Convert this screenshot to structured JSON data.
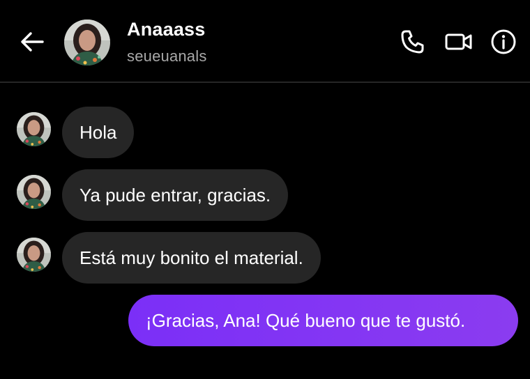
{
  "header": {
    "name": "Anaaass",
    "username": "seueuanals"
  },
  "icons": {
    "back": "arrow-left-icon",
    "call": "phone-icon",
    "video": "video-camera-icon",
    "info": "info-icon"
  },
  "colors": {
    "background": "#000000",
    "received_bubble": "#262626",
    "sent_bubble": "#7b2ff7",
    "secondary_text": "#a8a8a8"
  },
  "messages": [
    {
      "sender": "them",
      "text": "Hola"
    },
    {
      "sender": "them",
      "text": "Ya pude entrar, gracias."
    },
    {
      "sender": "them",
      "text": "Está muy bonito el material."
    },
    {
      "sender": "me",
      "text": "¡Gracias, Ana! Qué bueno que te gustó."
    }
  ]
}
